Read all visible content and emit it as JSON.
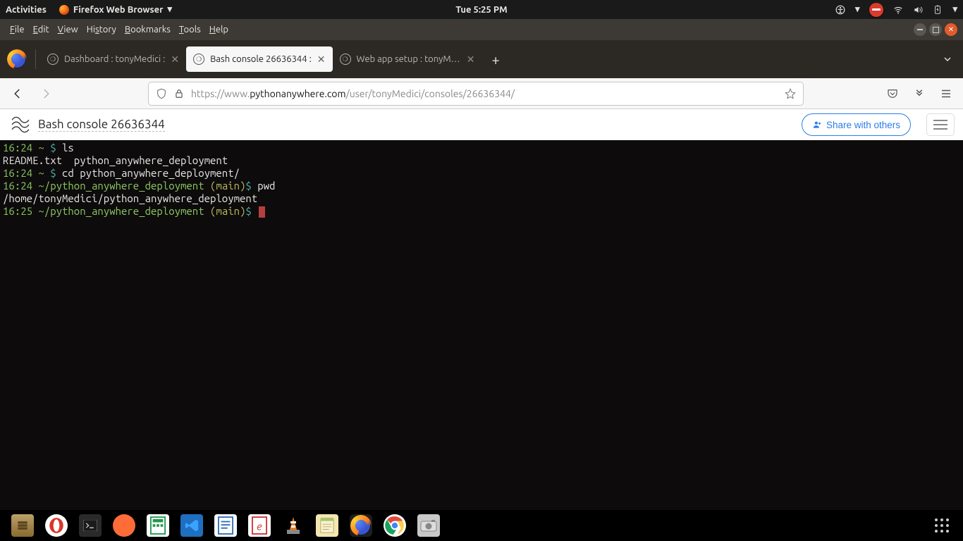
{
  "gnome": {
    "activities": "Activities",
    "app_label": "Firefox Web Browser",
    "clock": "Tue  5:25 PM"
  },
  "menubar": {
    "items": [
      "File",
      "Edit",
      "View",
      "History",
      "Bookmarks",
      "Tools",
      "Help"
    ]
  },
  "tabs": [
    {
      "label": "Dashboard : tonyMedici : ",
      "active": false
    },
    {
      "label": "Bash console 26636344 : ",
      "active": true
    },
    {
      "label": "Web app setup : tonyMed",
      "active": false
    }
  ],
  "url": {
    "scheme": "https://",
    "sub": "www.",
    "host": "pythonanywhere.com",
    "path": "/user/tonyMedici/consoles/26636344/"
  },
  "page": {
    "title": "Bash console 26636344",
    "share_label": "Share with others"
  },
  "terminal": {
    "lines": [
      {
        "t": "16:24 ~ ",
        "p": "$",
        "cmd": " ls"
      },
      {
        "plain": "README.txt  python_anywhere_deployment"
      },
      {
        "t": "16:24 ~ ",
        "p": "$",
        "cmd": " cd python_anywhere_deployment/"
      },
      {
        "t": "16:24 ~/python_anywhere_deployment ",
        "branch": "(main)",
        "p": "$",
        "cmd": " pwd"
      },
      {
        "plain": "/home/tonyMedici/python_anywhere_deployment"
      },
      {
        "t": "16:25 ~/python_anywhere_deployment ",
        "branch": "(main)",
        "p": "$",
        "cursor": true
      }
    ]
  },
  "dock": {
    "apps": [
      "files",
      "opera",
      "terminal",
      "postman",
      "calc",
      "vscode",
      "writer",
      "reader",
      "vlc",
      "notepad",
      "firefox",
      "chrome",
      "screenshot"
    ]
  }
}
